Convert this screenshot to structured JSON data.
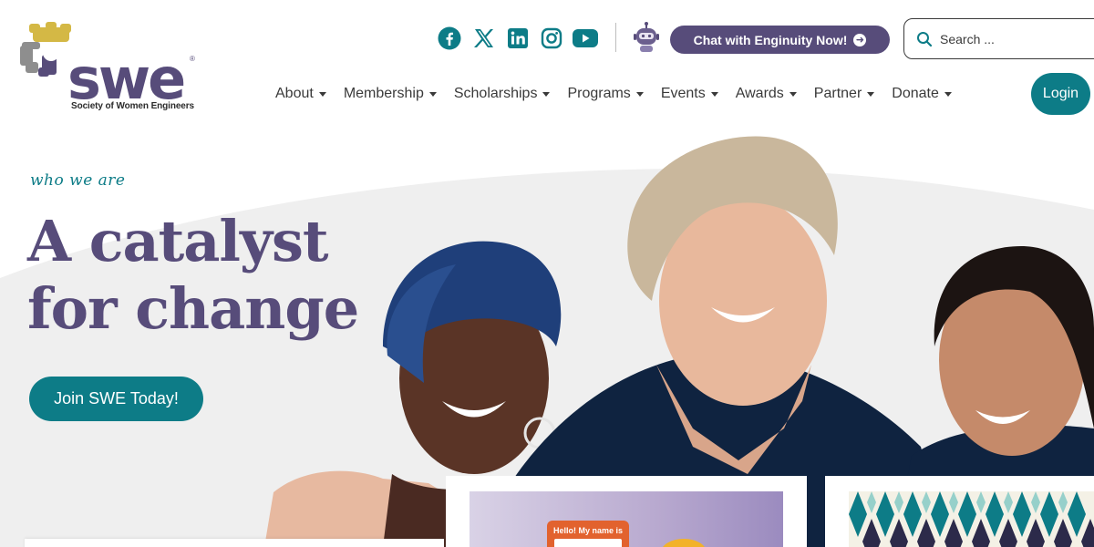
{
  "brand": {
    "logo_word": "swe",
    "logo_reg": "®",
    "logo_subtitle": "Society of Women Engineers",
    "colors": {
      "purple": "#574c7a",
      "teal": "#0d7c87",
      "gold": "#d4b845",
      "gray": "#8e8e8e"
    }
  },
  "header": {
    "social": [
      {
        "name": "facebook-icon"
      },
      {
        "name": "x-icon"
      },
      {
        "name": "linkedin-icon"
      },
      {
        "name": "instagram-icon"
      },
      {
        "name": "youtube-icon"
      }
    ],
    "chat_label": "Chat with Enginuity Now!",
    "search_placeholder": "Search ...",
    "login_label": "Login"
  },
  "nav": {
    "items": [
      {
        "label": "About"
      },
      {
        "label": "Membership"
      },
      {
        "label": "Scholarships"
      },
      {
        "label": "Programs"
      },
      {
        "label": "Events"
      },
      {
        "label": "Awards"
      },
      {
        "label": "Partner"
      },
      {
        "label": "Donate"
      }
    ]
  },
  "hero": {
    "eyebrow": "who we are",
    "headline": "A catalyst for change",
    "cta_label": "Join SWE Today!"
  },
  "cards": {
    "card1_tag": "Hello! My name is"
  }
}
